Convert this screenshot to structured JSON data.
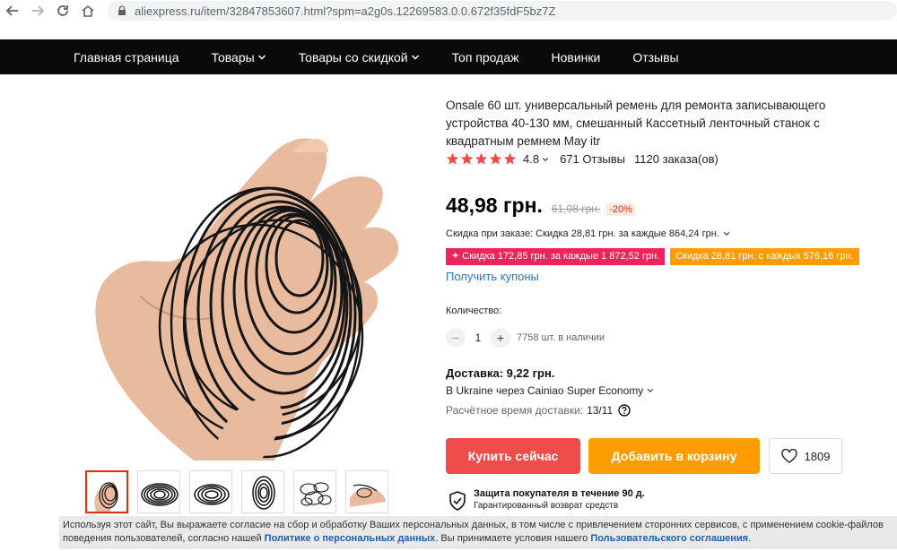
{
  "browser": {
    "url": "aliexpress.ru/item/32847853607.html?spm=a2g0s.12269583.0.0.672f35fdF5bz7Z",
    "icons": [
      "back-icon",
      "forward-icon",
      "reload-icon",
      "home-icon",
      "lock-icon"
    ]
  },
  "top_nav": {
    "items": [
      {
        "label": "Главная страница",
        "has_dropdown": false
      },
      {
        "label": "Товары",
        "has_dropdown": true
      },
      {
        "label": "Товары со скидкой",
        "has_dropdown": true
      },
      {
        "label": "Топ продаж",
        "has_dropdown": false
      },
      {
        "label": "Новинки",
        "has_dropdown": false
      },
      {
        "label": "Отзывы",
        "has_dropdown": false
      }
    ]
  },
  "product": {
    "title": "Onsale 60 шт. универсальный ремень для ремонта записывающего устройства 40-130 мм, смешанный Кассетный ленточный станок с квадратным ремнем May itr",
    "rating": "4.8",
    "stars_filled": 5,
    "reviews": "671 Отзывы",
    "orders": "1120 заказа(ов)",
    "price": "48,98 грн.",
    "old_price": "61,08 грн.",
    "discount": "-20%",
    "order_discount": "Скидка при заказе: Скидка 28,81 грн. за каждые 864,24 грн.",
    "coupons": [
      {
        "label": "✦ Скидка 172,85 грн. за каждые 1 872,52 грн.",
        "color": "#f0245c"
      },
      {
        "label": "Скидка 28,81 грн. с каждых 576,16 грн.",
        "color": "#ff9c00"
      }
    ],
    "get_coupons": "Получить купоны",
    "quantity_label": "Количество:",
    "quantity": "1",
    "stock": "7758 шт. в наличии",
    "delivery": "Доставка: 9,22 грн.",
    "delivery_method": "В Ukraine через Cainiao Super Economy",
    "delivery_time_label": "Расчётное время доставки:",
    "delivery_time": "13/11",
    "buy_now": "Купить сейчас",
    "add_to_cart": "Добавить в корзину",
    "wishlist_count": "1809",
    "protection_title": "Защита покупателя в течение 90 д.",
    "protection_sub": "Гарантированный возврат средств",
    "thumbnail_count": 6
  },
  "cookie": {
    "text1": "Используя этот сайт, Вы выражаете согласие на сбор и обработку Ваших персональных данных, в том числе с привлечением сторонних сервисов, с применением cookie-файлов",
    "text2": "поведения пользователей, согласно нашей ",
    "link1": "Политике о персональных данных",
    "text3": ". Вы принимаете условия нашего ",
    "link2": "Пользовательского соглашения",
    "text4": "."
  },
  "colors": {
    "nav_bg": "#0a0a0a",
    "accent_red": "#f04c4c",
    "accent_orange": "#ff9c00",
    "link_blue": "#2878c8",
    "star": "#f04c4c"
  }
}
